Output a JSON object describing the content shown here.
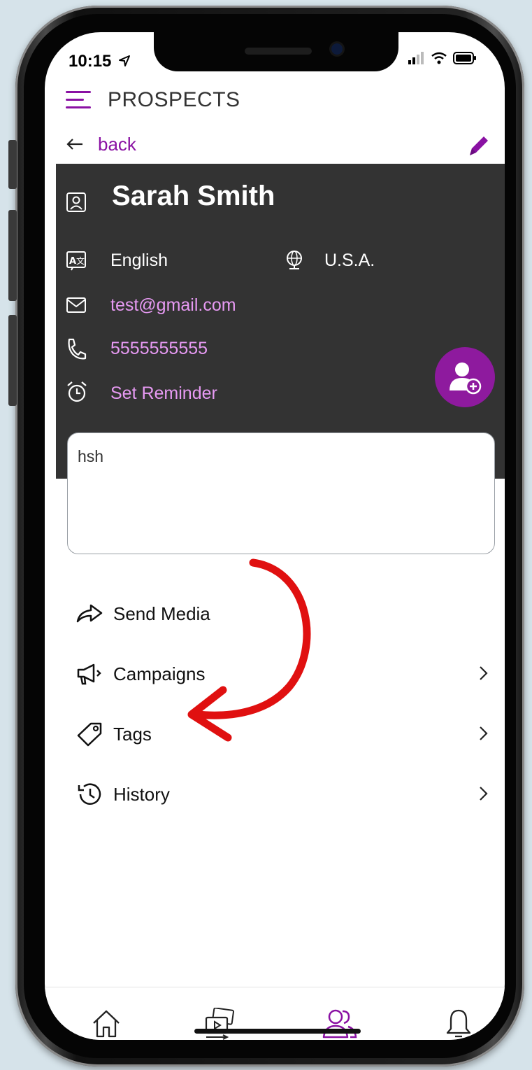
{
  "status_bar": {
    "time": "10:15"
  },
  "header": {
    "title": "PROSPECTS"
  },
  "nav": {
    "back_label": "back"
  },
  "contact": {
    "name": "Sarah Smith",
    "language": "English",
    "country": "U.S.A.",
    "email": "test@gmail.com",
    "phone": "5555555555",
    "reminder_label": "Set Reminder"
  },
  "notes": {
    "value": "hsh"
  },
  "menu": {
    "send_media": "Send Media",
    "campaigns": "Campaigns",
    "tags": "Tags",
    "history": "History"
  },
  "colors": {
    "accent": "#8a11a3",
    "card_bg": "#333333",
    "link_on_dark": "#e79af3",
    "annotation_arrow": "#e01010"
  },
  "bottom_nav": {
    "items": [
      {
        "icon": "home-icon",
        "active": false
      },
      {
        "icon": "media-gallery-icon",
        "active": false
      },
      {
        "icon": "people-icon",
        "active": true
      },
      {
        "icon": "bell-icon",
        "active": false
      }
    ]
  }
}
